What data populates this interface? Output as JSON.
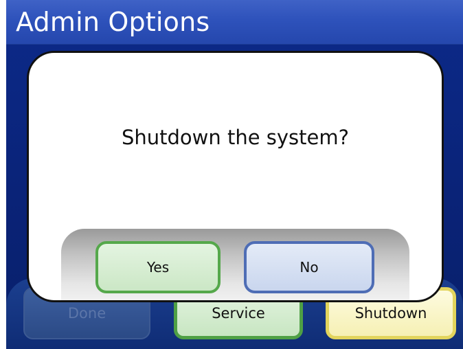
{
  "window": {
    "title": "Admin Options"
  },
  "bottom_buttons": {
    "done_label": "Done",
    "service_label": "Service",
    "shutdown_label": "Shutdown"
  },
  "dialog": {
    "message": "Shutdown the system?",
    "yes_label": "Yes",
    "no_label": "No"
  },
  "colors": {
    "title_bar": "#2e52bb",
    "background": "#0a2378",
    "service_border": "#4fa045",
    "shutdown_border": "#e2d45c",
    "yes_border": "#55a84b",
    "no_border": "#4e6db5"
  }
}
